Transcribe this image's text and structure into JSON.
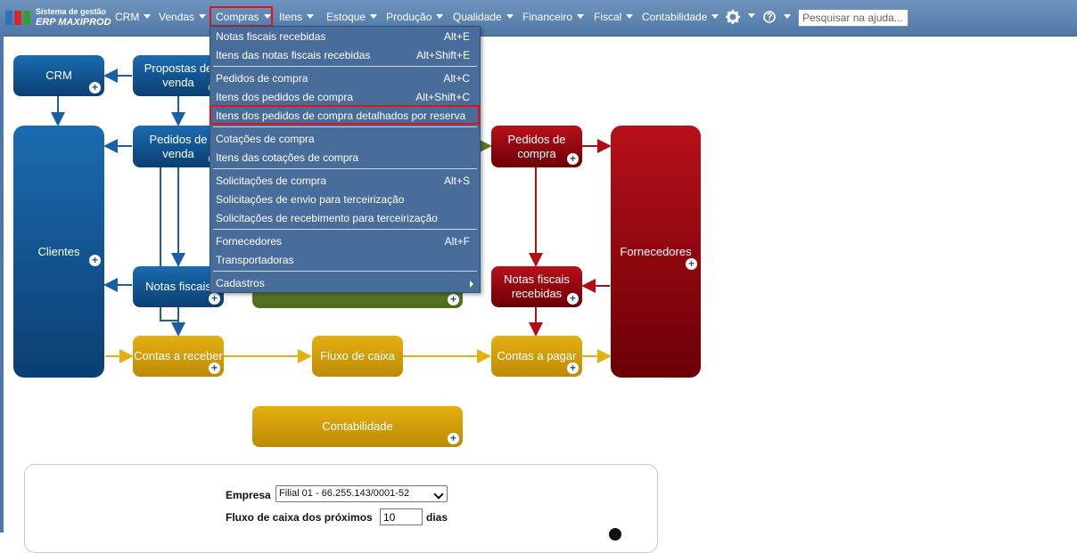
{
  "app": {
    "name_line1": "Sistema de gestão",
    "name_line2": "ERP MAXIPROD"
  },
  "menu": {
    "items": [
      {
        "label": "CRM"
      },
      {
        "label": "Vendas"
      },
      {
        "label": "Compras"
      },
      {
        "label": "Itens"
      },
      {
        "label": "Estoque"
      },
      {
        "label": "Produção"
      },
      {
        "label": "Qualidade"
      },
      {
        "label": "Financeiro"
      },
      {
        "label": "Fiscal"
      },
      {
        "label": "Contabilidade"
      }
    ],
    "settings_icon": "gear-icon",
    "help_icon": "help-icon",
    "search_placeholder": "Pesquisar na ajuda..."
  },
  "dropdown": {
    "items": [
      {
        "label": "Notas fiscais recebidas",
        "shortcut": "Alt+E"
      },
      {
        "label": "Itens das notas fiscais recebidas",
        "shortcut": "Alt+Shift+E"
      },
      {
        "label": "Pedidos de compra",
        "shortcut": "Alt+C"
      },
      {
        "label": "Itens dos pedidos de compra",
        "shortcut": "Alt+Shift+C"
      },
      {
        "label": "Itens dos pedidos de compra detalhados por reserva",
        "shortcut": ""
      },
      {
        "label": "Cotações de compra",
        "shortcut": ""
      },
      {
        "label": "Itens das cotações de compra",
        "shortcut": ""
      },
      {
        "label": "Solicitações de compra",
        "shortcut": "Alt+S"
      },
      {
        "label": "Solicitações de envio para terceirização",
        "shortcut": ""
      },
      {
        "label": "Solicitações de recebimento para terceirização",
        "shortcut": ""
      },
      {
        "label": "Fornecedores",
        "shortcut": "Alt+F"
      },
      {
        "label": "Transportadoras",
        "shortcut": ""
      },
      {
        "label": "Cadastros",
        "shortcut": ""
      }
    ]
  },
  "diagram": {
    "crm": "CRM",
    "propostas": "Propostas de venda",
    "pedidos_venda": "Pedidos de venda",
    "clientes": "Clientes",
    "notas_fiscais": "Notas fiscais",
    "contas_receber": "Contas a receber",
    "fluxo_caixa": "Fluxo de caixa",
    "contas_pagar": "Contas a pagar",
    "pedidos_compra": "Pedidos de compra",
    "notas_recebidas": "Notas fiscais recebidas",
    "fornecedores": "Fornecedores",
    "contabilidade": "Contabilidade",
    "colors": {
      "blue": "#0b3f72",
      "red": "#8a0008",
      "gold": "#d4a00a",
      "green": "#5a7d26"
    }
  },
  "panel": {
    "empresa_label": "Empresa",
    "empresa_value": "Filial 01 - 66.255.143/0001-52",
    "fluxo_label": "Fluxo de caixa dos próximos",
    "fluxo_days": "10",
    "dias_label": "dias"
  }
}
